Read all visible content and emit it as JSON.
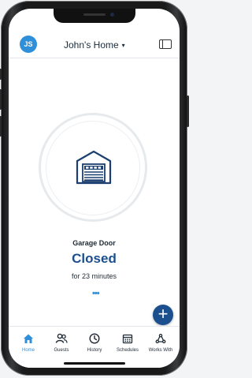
{
  "header": {
    "avatar_initials": "JS",
    "home_name": "John's Home",
    "chevron": "▾"
  },
  "device": {
    "name": "Garage Door",
    "status": "Closed",
    "duration": "for 23 minutes",
    "more": "•••",
    "icon": "garage-door-icon"
  },
  "fab": {
    "label": "+"
  },
  "tabs": [
    {
      "label": "Home",
      "icon": "home-icon",
      "active": true
    },
    {
      "label": "Guests",
      "icon": "guests-icon",
      "active": false
    },
    {
      "label": "History",
      "icon": "history-icon",
      "active": false
    },
    {
      "label": "Schedules",
      "icon": "schedules-icon",
      "active": false
    },
    {
      "label": "Works With",
      "icon": "works-with-icon",
      "active": false
    }
  ],
  "colors": {
    "accent": "#2f8fd8",
    "status": "#1b4f8e",
    "fab": "#1b4f8e"
  }
}
